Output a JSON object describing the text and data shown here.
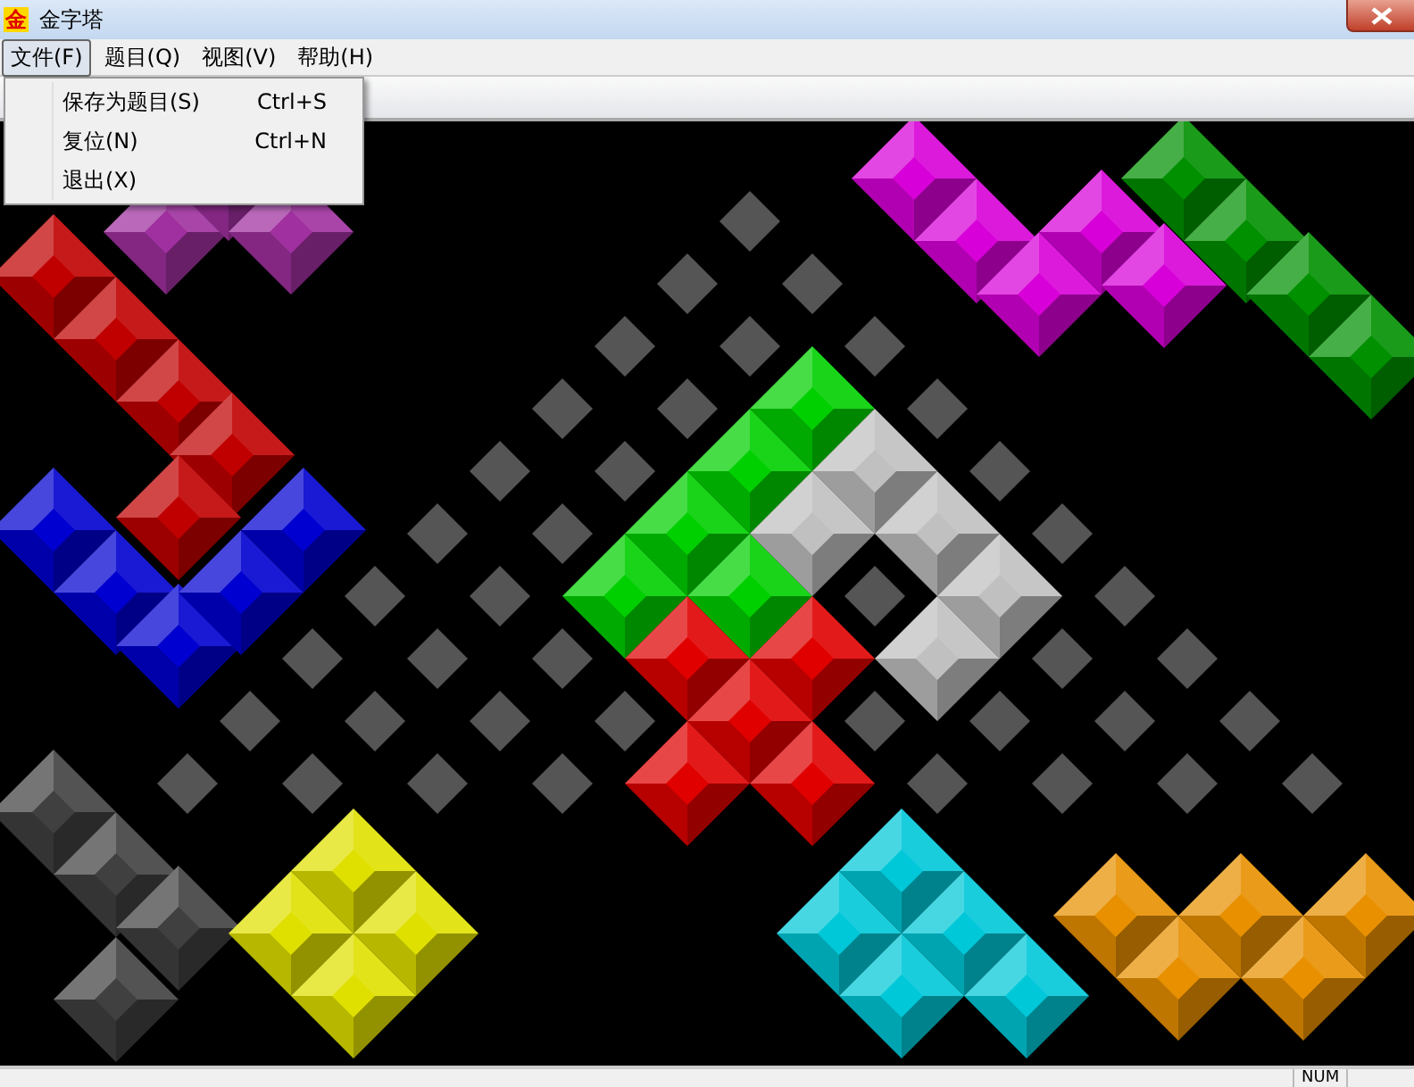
{
  "window": {
    "title": "金字塔",
    "icon_text": "金"
  },
  "menu_bar": [
    {
      "label": "文件(F)",
      "selected": true
    },
    {
      "label": "题目(Q)",
      "selected": false
    },
    {
      "label": "视图(V)",
      "selected": false
    },
    {
      "label": "帮助(H)",
      "selected": false
    }
  ],
  "open_menu": {
    "items": [
      {
        "label": "保存为题目(S)",
        "shortcut": "Ctrl+S"
      },
      {
        "label": "复位(N)",
        "shortcut": "Ctrl+N"
      },
      {
        "label": "退出(X)"
      }
    ]
  },
  "board": {
    "pieces": [
      {
        "color": "#d800d8"
      },
      {
        "color": "#009000"
      },
      {
        "color": "#a030a0"
      },
      {
        "color": "#c00000"
      },
      {
        "color": "#0000d0"
      },
      {
        "color": "#00d000"
      },
      {
        "color": "#c0c0c0"
      },
      {
        "color": "#e00000"
      },
      {
        "color": "#404040"
      },
      {
        "color": "#e0e000"
      },
      {
        "color": "#00c8d8"
      },
      {
        "color": "#e89000"
      }
    ]
  },
  "status_bar": {
    "indicator": "NUM"
  }
}
